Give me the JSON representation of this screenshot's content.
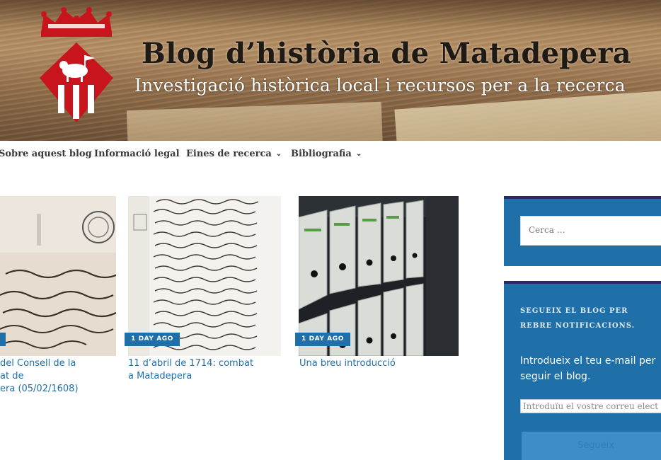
{
  "header": {
    "title": "Blog d’història de Matadepera",
    "tagline": "Investigació històrica local i recursos per a la recerca"
  },
  "nav": {
    "items": [
      {
        "label": "Sobre aquest blog"
      },
      {
        "label": "Informació legal"
      },
      {
        "label": "Eines de recerca",
        "has_dropdown": true
      },
      {
        "label": "Bibliografia",
        "has_dropdown": true
      }
    ]
  },
  "posts": [
    {
      "badge": "",
      "title": "del Consell de la\nat de\nera (05/02/1608)"
    },
    {
      "badge": "1 DAY AGO",
      "title": "11 d’abril de 1714: combat\na Matadepera"
    },
    {
      "badge": "1 DAY AGO",
      "title": "Una breu introducció"
    }
  ],
  "sidebar": {
    "search": {
      "placeholder": "Cerca …"
    },
    "follow": {
      "heading": "SEGUEIX EL BLOG PER REBRE NOTIFICACIONS.",
      "text": "Introdueix el teu e-mail per seguir el blog.",
      "email_placeholder": "Introduïu el vostre correu elect",
      "button_label": "Segueix"
    }
  },
  "colors": {
    "accent": "#1f6fa8",
    "widget_border": "#2b2a66",
    "crest_red": "#c8141c"
  }
}
